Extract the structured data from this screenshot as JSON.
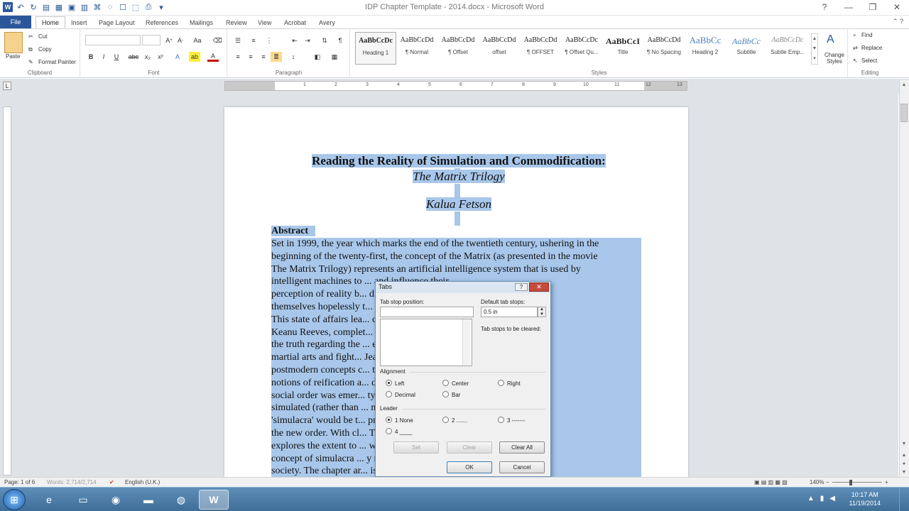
{
  "window": {
    "title": "IDP Chapter Template - 2014.docx - Microsoft Word",
    "controls": [
      "?",
      "—",
      "❐",
      "✕"
    ]
  },
  "qat": [
    "W",
    "↶",
    "↻",
    "▤",
    "▦",
    "▣",
    "▥",
    "⌘",
    "◌",
    "☐",
    "⬚",
    "⎙",
    "▾"
  ],
  "ribbon": {
    "file_tab": "File",
    "tabs": [
      "Home",
      "Insert",
      "Page Layout",
      "References",
      "Mailings",
      "Review",
      "View",
      "Acrobat",
      "Avery"
    ],
    "active_tab": "Home",
    "clipboard": {
      "paste": "Paste",
      "cut": "Cut",
      "copy": "Copy",
      "format_painter": "Format Painter",
      "label": "Clipboard"
    },
    "font": {
      "label": "Font"
    },
    "paragraph": {
      "label": "Paragraph"
    },
    "styles": {
      "label": "Styles",
      "items": [
        {
          "sample": "AaBbCcDc",
          "name": "Heading 1"
        },
        {
          "sample": "AaBbCcDd",
          "name": "¶ Normal"
        },
        {
          "sample": "AaBbCcDd",
          "name": "¶ Offset"
        },
        {
          "sample": "AaBbCcDd",
          "name": "offset"
        },
        {
          "sample": "AaBbCcDd",
          "name": "¶ OFFSET"
        },
        {
          "sample": "AaBbCcDc",
          "name": "¶ Offset Qu..."
        },
        {
          "sample": "AaBbCcI",
          "name": "Title"
        },
        {
          "sample": "AaBbCcDd",
          "name": "¶ No Spacing"
        },
        {
          "sample": "AaBbCc",
          "name": "Heading 2"
        },
        {
          "sample": "AaBbCc",
          "name": "Subtitle"
        },
        {
          "sample": "AaBbCcDc",
          "name": "Subtle Emp..."
        }
      ],
      "change_styles": "Change Styles"
    },
    "editing": {
      "find": "Find",
      "replace": "Replace",
      "select": "Select",
      "label": "Editing"
    }
  },
  "ruler": {
    "numbers": [
      "1",
      "2",
      "3",
      "4",
      "5",
      "6",
      "7",
      "8",
      "9",
      "10",
      "11",
      "12",
      "13"
    ]
  },
  "document": {
    "title": "Reading the Reality of Simulation and Commodification:",
    "subtitle": "The Matrix Trilogy",
    "author": "Kalua Fetson",
    "abstract_heading": "Abstract",
    "abstract_lines": [
      "Set in 1999, the year which marks the end of the twentieth century, ushering in the",
      "beginning of the twenty-first, the concept of the Matrix (as presented in the movie",
      "The Matrix Trilogy) represents an artificial intelligence system that is used by",
      "intelligent machines to ... and influence their",
      "perception of reality b... d. The humans find",
      "themselves hopelessly t... n world of illusions.",
      "This state of affairs lea... character played by",
      "Keanu Reeves, complet... n the quest to get at",
      "the truth regarding the ... effects and new age",
      "martial arts and fight... Jean Baudrillard's",
      "postmodern concepts c... ther with the related",
      "notions of reification a... d, a completely new",
      "social order was emer... ty, characterised by",
      "simulated (rather than ... n other words, the",
      "'simulacra' would be t... presenting reality in",
      "the new order. With cl... Trilogy), this chapter",
      "explores the extent to ... which exemplify the",
      "concept of simulacra ... y reality in modern",
      "society. The chapter ar... is representative of"
    ]
  },
  "dialog": {
    "title": "Tabs",
    "help": "?",
    "close": "✕",
    "tab_stop_position_label": "Tab stop position:",
    "tab_stop_position_value": "",
    "default_tab_stops_label": "Default tab stops:",
    "default_tab_stops_value": "0.5 in",
    "to_be_cleared_label": "Tab stops to be cleared:",
    "alignment_label": "Alignment",
    "alignment_options": [
      "Left",
      "Center",
      "Right",
      "Decimal",
      "Bar"
    ],
    "alignment_selected": "Left",
    "leader_label": "Leader",
    "leader_options": [
      "1 None",
      "2 .......",
      "3 -------",
      "4 ____"
    ],
    "leader_selected": "1 None",
    "buttons": {
      "set": "Set",
      "clear": "Clear",
      "clear_all": "Clear All",
      "ok": "OK",
      "cancel": "Cancel"
    }
  },
  "statusbar": {
    "page": "Page: 1 of 6",
    "words": "Words: 2,714/2,714",
    "language": "English (U.K.)",
    "zoom": "140%"
  },
  "taskbar": {
    "time": "10:17 AM",
    "date": "11/19/2014"
  }
}
